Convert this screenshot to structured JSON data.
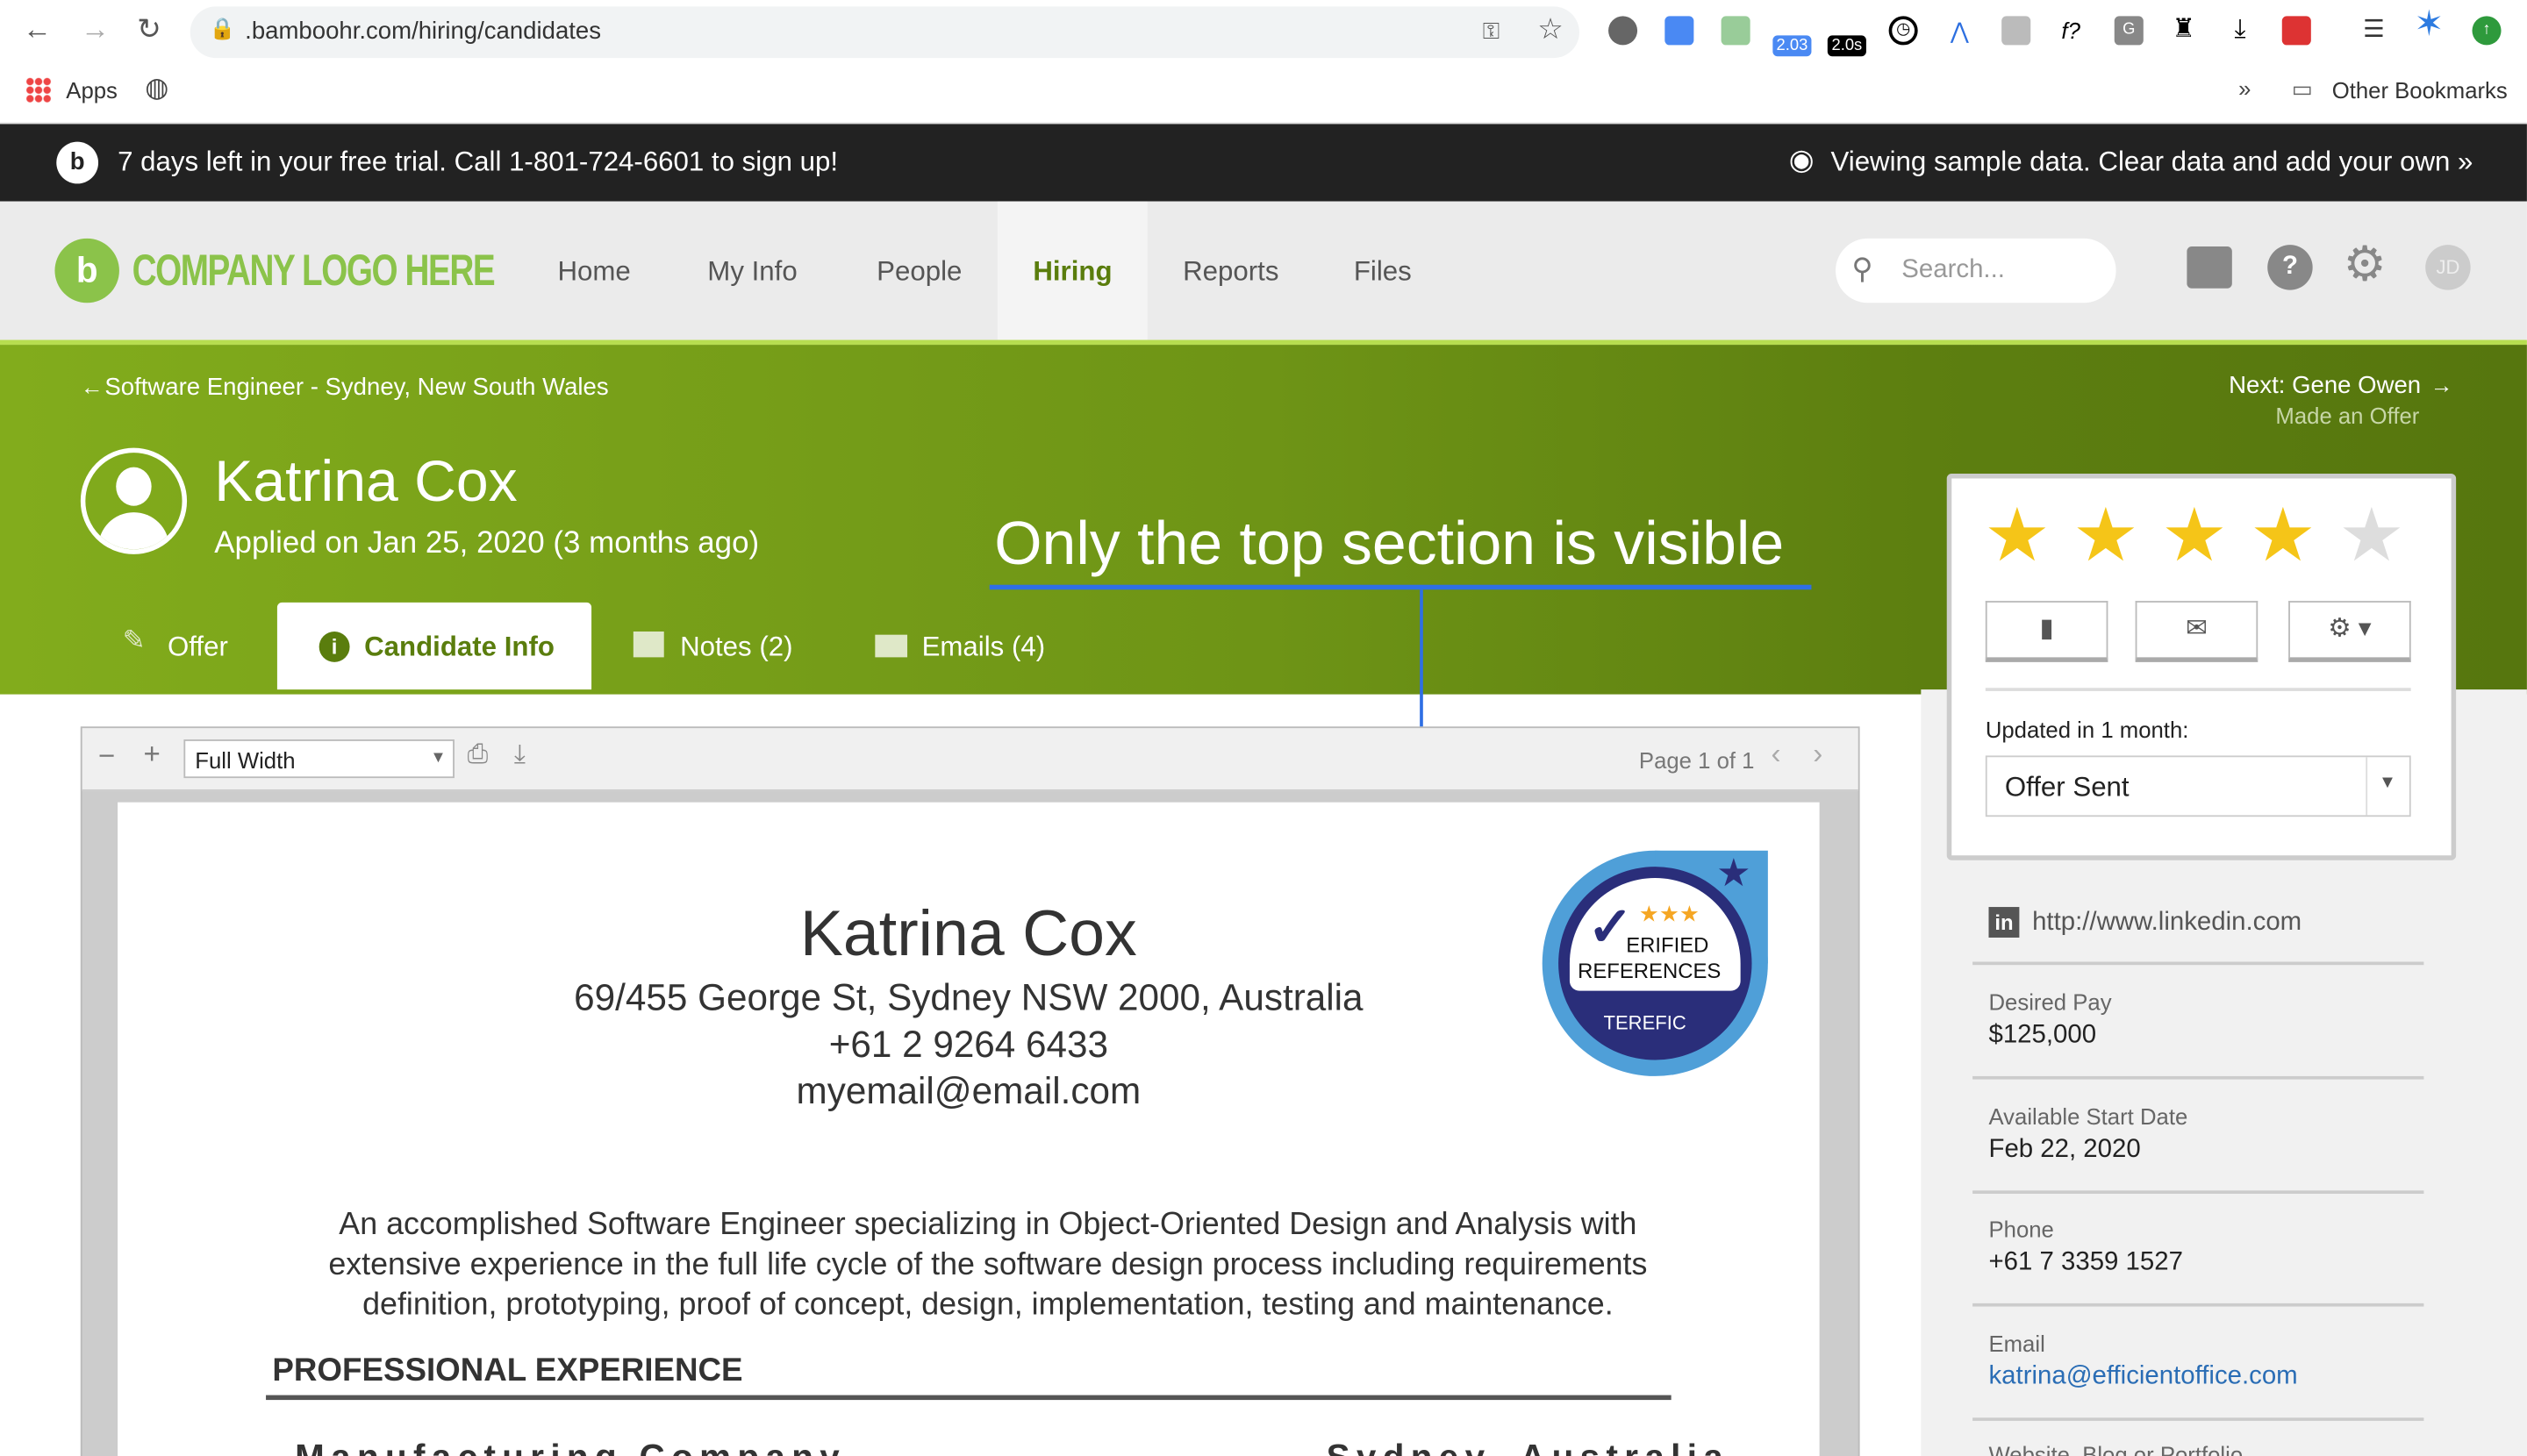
{
  "browser": {
    "url": ".bamboohr.com/hiring/candidates",
    "bookmarks_apps": "Apps",
    "other_bookmarks": "Other Bookmarks",
    "ext_badge_1": "2.03",
    "ext_badge_2": "2.0s",
    "ext_f": "f?",
    "ext_g": "G",
    "more": "»"
  },
  "trial_bar": {
    "message": "7 days left in your free trial. Call 1-801-724-6601 to sign up!",
    "sample": "Viewing sample data. Clear data and add your own »"
  },
  "nav": {
    "logo": "COMPANY LOGO HERE",
    "items": [
      {
        "label": "Home"
      },
      {
        "label": "My Info"
      },
      {
        "label": "People"
      },
      {
        "label": "Hiring"
      },
      {
        "label": "Reports"
      },
      {
        "label": "Files"
      }
    ],
    "active": "Hiring",
    "search_placeholder": "Search...",
    "avatar": "JD"
  },
  "candidate": {
    "back_link": "Software Engineer - Sydney, New South Wales",
    "next_label": "Next: Gene Owen",
    "next_status": "Made an Offer",
    "name": "Katrina Cox",
    "applied": "Applied on Jan 25, 2020 (3 months ago)",
    "rating": 4,
    "rating_max": 5
  },
  "annotation": {
    "text": "Only the top section is visible",
    "color": "#2f6fe4"
  },
  "tabs": [
    {
      "label": "Offer"
    },
    {
      "label": "Candidate Info"
    },
    {
      "label": "Notes (2)"
    },
    {
      "label": "Emails (4)"
    }
  ],
  "status_card": {
    "updated": "Updated in 1 month:",
    "status": "Offer Sent"
  },
  "details": {
    "linkedin": "http://www.linkedin.com",
    "fields": [
      {
        "label": "Desired Pay",
        "value": "$125,000"
      },
      {
        "label": "Available Start Date",
        "value": "Feb 22, 2020"
      },
      {
        "label": "Phone",
        "value": "+61 7 3359 1527"
      },
      {
        "label": "Email",
        "value": "katrina@efficientoffice.com"
      },
      {
        "label": "Website, Blog or Portfolio"
      }
    ]
  },
  "viewer": {
    "zoom": "Full Width",
    "page": "Page 1 of 1"
  },
  "resume": {
    "name": "Katrina Cox",
    "address": "69/455 George St, Sydney NSW 2000, Australia",
    "phone": "+61 2 9264 6433",
    "email": "myemail@email.com",
    "summary": "An accomplished Software Engineer specializing in Object-Oriented Design and Analysis with extensive experience in the full life cycle of the software design process including requirements definition, prototyping, proof of concept, design,  implementation, testing and maintenance.",
    "section": "PROFESSIONAL EXPERIENCE",
    "company": "Manufacturing Company",
    "location": "Sydney, Australia",
    "badge": {
      "line1": "ERIFIED",
      "line2": "REFERENCES",
      "brand": "TEREFIC"
    }
  },
  "colors": {
    "brand_green": "#7aa61a",
    "dark_bar": "#222222",
    "star": "#f5c518",
    "link": "#2a6db5"
  }
}
